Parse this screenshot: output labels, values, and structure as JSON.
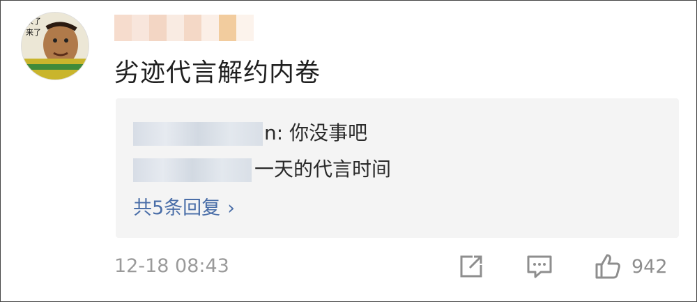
{
  "comment": {
    "avatar_caption_line1": "来了",
    "avatar_caption_line2": "来了",
    "text": "劣迹代言解约内卷",
    "timestamp": "12-18 08:43"
  },
  "replies": [
    {
      "lead_char": "",
      "tail": "n: 你没事吧"
    },
    {
      "lead_char": "",
      "tail": "一天的代言时间"
    }
  ],
  "more_replies_label": "共5条回复",
  "more_replies_chevron": "›",
  "actions": {
    "like_count": "942",
    "share_icon": "share-icon",
    "reply_icon": "comment-icon",
    "like_icon": "thumbs-up-icon"
  },
  "colors": {
    "link": "#4a6ea8",
    "meta": "#9a9a9a",
    "reply_bg": "#f4f4f4"
  }
}
